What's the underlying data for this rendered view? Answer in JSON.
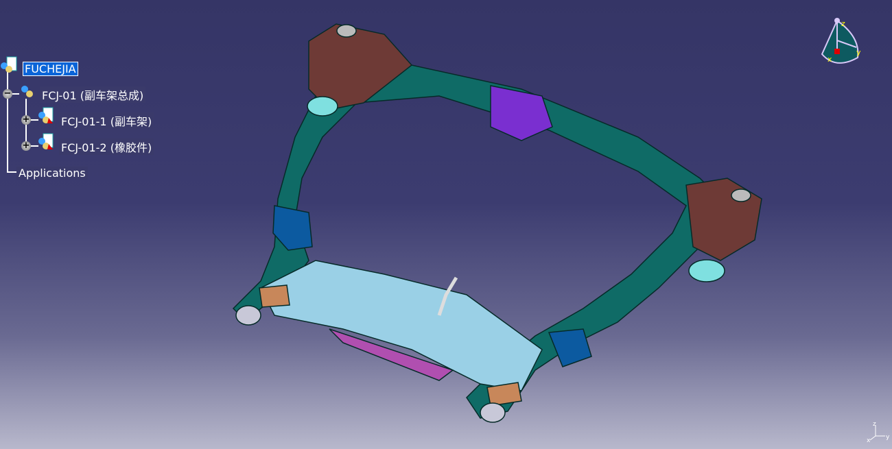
{
  "tree": {
    "root": "FUCHEJIA",
    "product": "FCJ-01 (副车架总成)",
    "children": [
      {
        "label": "FCJ-01-1 (副车架)"
      },
      {
        "label": "FCJ-01-2 (橡胶件)"
      }
    ],
    "applications": "Applications"
  },
  "compass": {
    "x": "x",
    "y": "y",
    "z": "z"
  },
  "axes": {
    "x": "x",
    "y": "y",
    "z": "z"
  },
  "colors": {
    "frame": "#0f6b66",
    "bracket_brown": "#6e3a36",
    "bracket_purple": "#7a2fd0",
    "crossmember": "#9ad0e6",
    "pad": "#c8875a"
  }
}
